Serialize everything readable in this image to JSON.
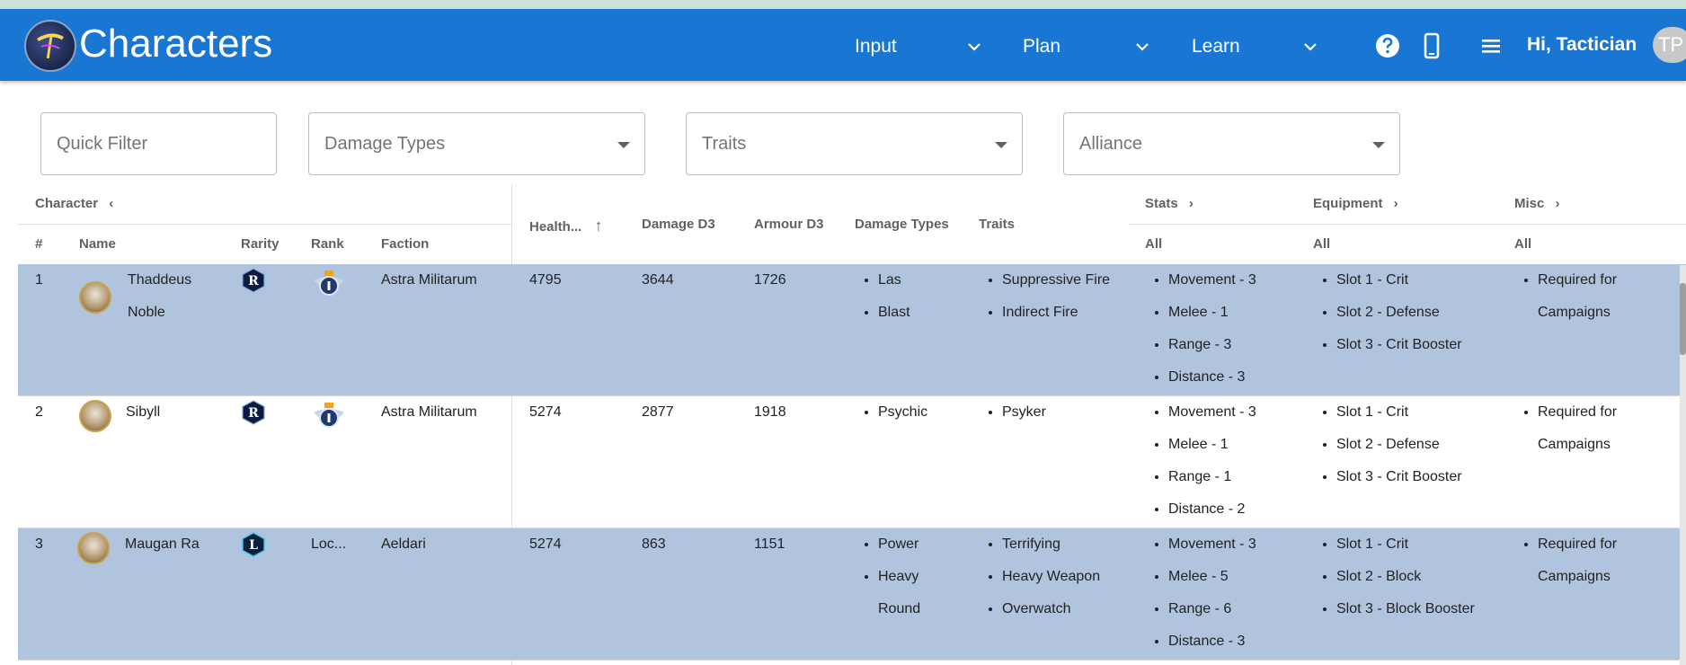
{
  "app": {
    "title": "Characters",
    "greeting": "Hi, Tactician",
    "avatar_initials": "TP"
  },
  "nav": [
    {
      "label": "Input"
    },
    {
      "label": "Plan"
    },
    {
      "label": "Learn"
    }
  ],
  "toolbar_icons": [
    "help-icon",
    "mobile-icon",
    "menu-icon"
  ],
  "filters": {
    "quick": "Quick Filter",
    "damage_types": "Damage Types",
    "traits": "Traits",
    "alliance": "Alliance"
  },
  "groups": {
    "character": "Character",
    "stats": "Stats",
    "equipment": "Equipment",
    "misc": "Misc"
  },
  "columns": {
    "num": "#",
    "name": "Name",
    "rarity": "Rarity",
    "rank": "Rank",
    "faction": "Faction",
    "health": "Health...",
    "damage": "Damage D3",
    "armour": "Armour D3",
    "damage_types": "Damage Types",
    "traits": "Traits",
    "stats": "All",
    "equipment": "All",
    "misc": "All"
  },
  "colors": {
    "appbar": "#1976d2",
    "row_highlight": "#b0c4de"
  },
  "rows": [
    {
      "num": "1",
      "name1": "Thaddeus",
      "name2": "Noble",
      "rarity": "R",
      "rank": "",
      "faction": "Astra Militarum",
      "health": "4795",
      "damage": "3644",
      "armour": "1726",
      "damage_types": [
        "Las",
        "Blast"
      ],
      "traits": [
        "Suppressive Fire",
        "Indirect Fire"
      ],
      "stats": [
        "Movement - 3",
        "Melee - 1",
        "Range - 3",
        "Distance - 3"
      ],
      "equipment": [
        "Slot 1 - Crit",
        "Slot 2 - Defense",
        "Slot 3 - Crit Booster"
      ],
      "misc1": "Required for",
      "misc2": "Campaigns"
    },
    {
      "num": "2",
      "name1": "Sibyll",
      "name2": "",
      "rarity": "R",
      "rank": "",
      "faction": "Astra Militarum",
      "health": "5274",
      "damage": "2877",
      "armour": "1918",
      "damage_types": [
        "Psychic"
      ],
      "traits": [
        "Psyker"
      ],
      "stats": [
        "Movement - 3",
        "Melee - 1",
        "Range - 1",
        "Distance - 2"
      ],
      "equipment": [
        "Slot 1 - Crit",
        "Slot 2 - Defense",
        "Slot 3 - Crit Booster"
      ],
      "misc1": "Required for",
      "misc2": "Campaigns"
    },
    {
      "num": "3",
      "name1": "Maugan Ra",
      "name2": "",
      "rarity": "L",
      "rank": "Loc...",
      "faction": "Aeldari",
      "health": "5274",
      "damage": "863",
      "armour": "1151",
      "damage_types": [
        "Power",
        "Heavy",
        "Round"
      ],
      "traits": [
        "Terrifying",
        "Heavy Weapon",
        "Overwatch"
      ],
      "stats": [
        "Movement - 3",
        "Melee - 5",
        "Range - 6",
        "Distance - 3"
      ],
      "equipment": [
        "Slot 1 - Crit",
        "Slot 2 - Block",
        "Slot 3 - Block Booster"
      ],
      "misc1": "Required for",
      "misc2": "Campaigns"
    }
  ]
}
